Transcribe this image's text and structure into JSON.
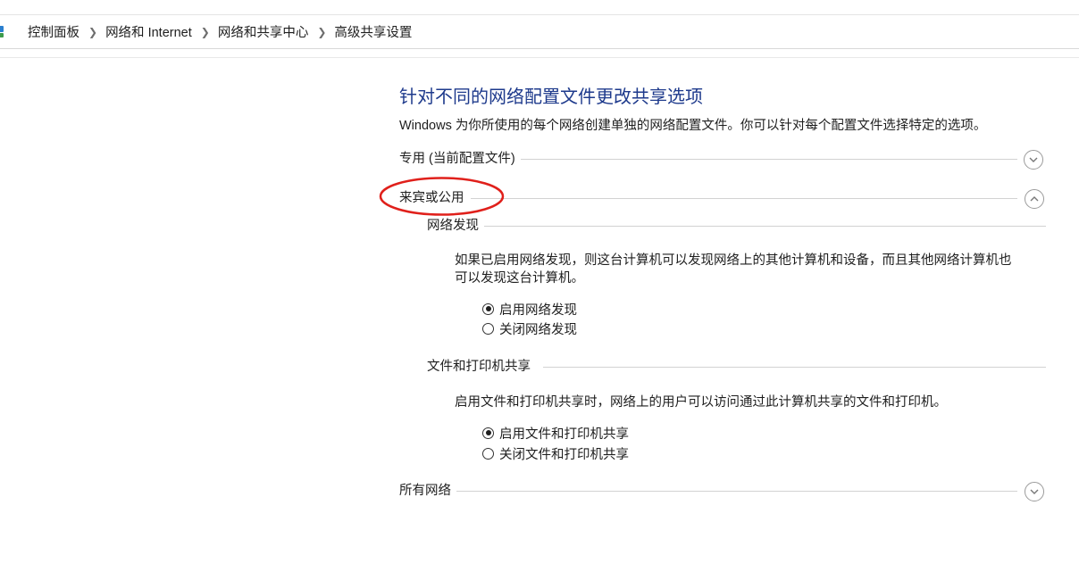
{
  "breadcrumb": {
    "items": [
      "控制面板",
      "网络和 Internet",
      "网络和共享中心",
      "高级共享设置"
    ]
  },
  "page": {
    "title": "针对不同的网络配置文件更改共享选项",
    "description": "Windows 为你所使用的每个网络创建单独的网络配置文件。你可以针对每个配置文件选择特定的选项。"
  },
  "profiles": {
    "private": {
      "label": "专用 (当前配置文件)",
      "expanded": false
    },
    "guest": {
      "label": "来宾或公用",
      "expanded": true
    },
    "all": {
      "label": "所有网络",
      "expanded": false
    }
  },
  "network_discovery": {
    "heading": "网络发现",
    "description_line1": "如果已启用网络发现，则这台计算机可以发现网络上的其他计算机和设备，而且其他网络计算机也",
    "description_line2": "可以发现这台计算机。",
    "option_on": "启用网络发现",
    "option_off": "关闭网络发现",
    "selected": "on"
  },
  "file_printer_sharing": {
    "heading": "文件和打印机共享",
    "description": "启用文件和打印机共享时，网络上的用户可以访问通过此计算机共享的文件和打印机。",
    "option_on": "启用文件和打印机共享",
    "option_off": "关闭文件和打印机共享",
    "selected": "on"
  },
  "colors": {
    "title": "#1e3a8c",
    "highlight": "#e0201b"
  }
}
